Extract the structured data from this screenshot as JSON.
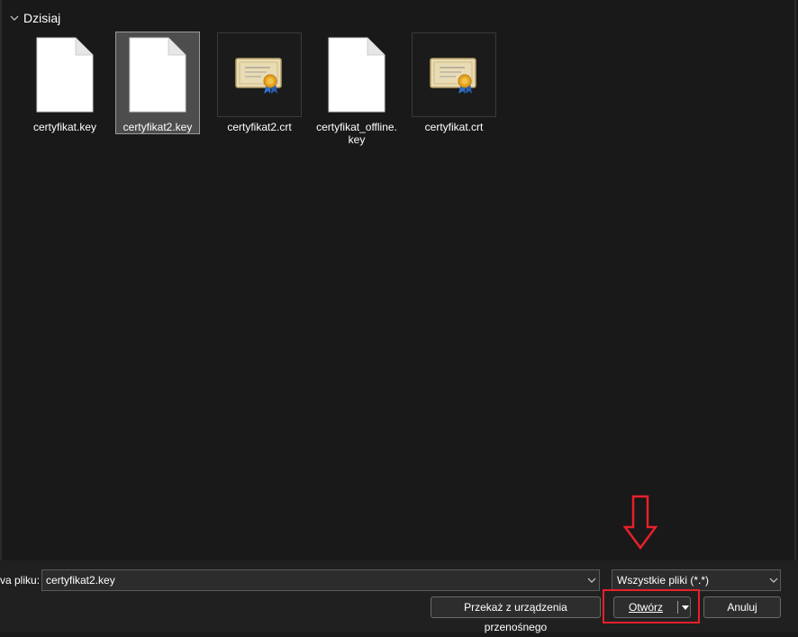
{
  "group": {
    "header": "Dzisiaj",
    "icon": "chevron-down-icon"
  },
  "files": [
    {
      "name": "certyfikat.key",
      "icon": "blank-file-icon",
      "selected": false
    },
    {
      "name": "certyfikat2.key",
      "icon": "blank-file-icon",
      "selected": true
    },
    {
      "name": "certyfikat2.crt",
      "icon": "certificate-icon",
      "selected": false
    },
    {
      "name": "certyfikat_offline.\nkey",
      "icon": "blank-file-icon",
      "selected": false
    },
    {
      "name": "certyfikat.crt",
      "icon": "certificate-icon",
      "selected": false
    }
  ],
  "footer": {
    "filename_label": "va pliku:",
    "filename_value": "certyfikat2.key",
    "filter_value": "Wszystkie pliki (*.*)",
    "portable_label": "Przekaż z urządzenia przenośnego",
    "open_label": "Otwórz",
    "cancel_label": "Anuluj"
  },
  "annotations": {
    "highlight_color": "#e8202a",
    "arrow_color": "#e8202a"
  },
  "colors": {
    "background": "#191919",
    "selection": "#4d4d4d",
    "accent": "#e8202a"
  }
}
